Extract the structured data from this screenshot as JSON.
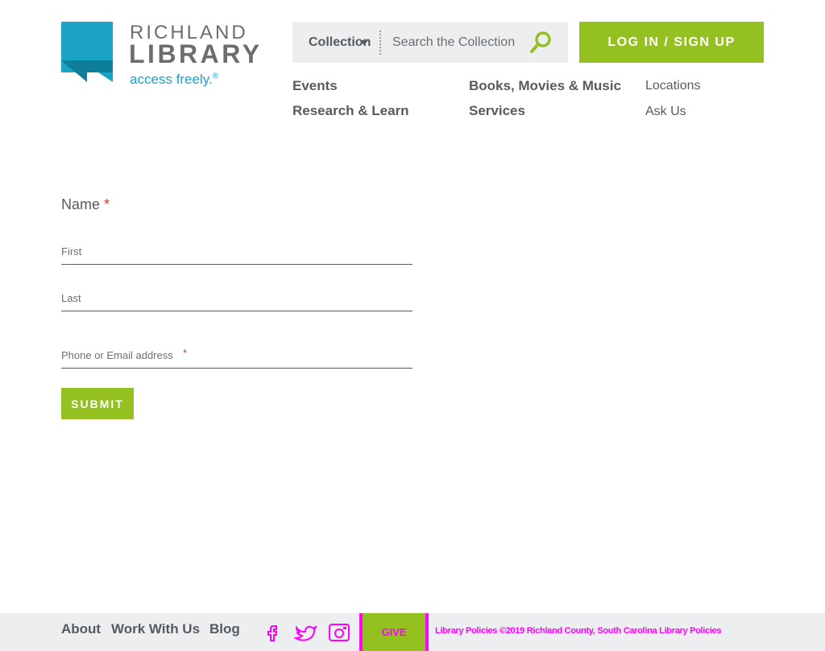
{
  "logo": {
    "name_line1": "RICHLAND",
    "name_line2": "LIBRARY",
    "tagline": "access freely.",
    "tagline_mark": "®",
    "colors": {
      "mark": "#1aa3c4",
      "text": "#6b6e71"
    }
  },
  "search": {
    "scope_label": "Collection",
    "placeholder": "Search the Collection",
    "icon": "search-icon"
  },
  "login": {
    "label": "LOG IN / SIGN UP"
  },
  "nav": {
    "col1": [
      "Events",
      "Research & Learn"
    ],
    "col2": [
      "Books, Movies & Music",
      "Services"
    ],
    "col3": [
      "Locations",
      "Ask Us"
    ]
  },
  "form": {
    "legend": "Name",
    "required_mark": "*",
    "first_placeholder": "First",
    "last_placeholder": "Last",
    "contact_placeholder": "Phone or Email address",
    "submit_label": "SUBMIT"
  },
  "footer": {
    "links": [
      "About",
      "Work With Us",
      "Blog"
    ],
    "social_icons": [
      "facebook-icon",
      "twitter-icon",
      "instagram-icon"
    ],
    "give_label": "GIVE",
    "legal": {
      "policies": "Library Policies",
      "copyright": "©2019 Richland County, South Carolina",
      "tail": "Library Policies"
    }
  },
  "colors": {
    "accent_green": "#94c11f",
    "brand_blue": "#1aa3c4",
    "text_gray": "#575b5e",
    "panel_gray": "#eceef0",
    "required_red": "#d9342b",
    "footer_magenta": "#ff00ff"
  }
}
